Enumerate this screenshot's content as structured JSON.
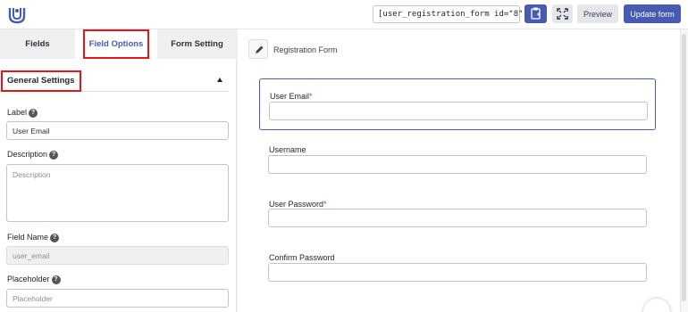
{
  "topbar": {
    "shortcode": "[user_registration_form id=\"8\"]",
    "preview_label": "Preview",
    "update_label": "Update form"
  },
  "left": {
    "tabs": [
      {
        "label": "Fields"
      },
      {
        "label": "Field Options"
      },
      {
        "label": "Form Setting"
      }
    ],
    "section_title": "General Settings",
    "label_label": "Label",
    "label_value": "User Email",
    "description_label": "Description",
    "description_placeholder": "Description",
    "field_name_label": "Field Name",
    "field_name_value": "user_email",
    "placeholder_label": "Placeholder",
    "placeholder_placeholder": "Placeholder"
  },
  "right": {
    "form_title": "Registration Form",
    "fields": [
      {
        "label": "User Email",
        "required": "*"
      },
      {
        "label": "Username",
        "required": ""
      },
      {
        "label": "User Password",
        "required": "*"
      },
      {
        "label": "Confirm Password",
        "required": ""
      }
    ]
  },
  "colors": {
    "accent": "#475bb2",
    "highlight": "#e5161b",
    "required": "#d63638"
  }
}
